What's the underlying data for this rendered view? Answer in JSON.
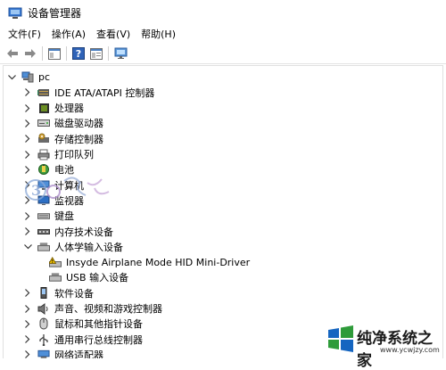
{
  "window": {
    "title": "设备管理器"
  },
  "menu": [
    "文件(F)",
    "操作(A)",
    "查看(V)",
    "帮助(H)"
  ],
  "tree": {
    "root": "pc",
    "items": [
      {
        "label": "IDE ATA/ATAPI 控制器",
        "icon": "ide-controller-icon",
        "expanded": false
      },
      {
        "label": "处理器",
        "icon": "processor-icon",
        "expanded": false
      },
      {
        "label": "磁盘驱动器",
        "icon": "disk-drive-icon",
        "expanded": false
      },
      {
        "label": "存储控制器",
        "icon": "storage-controller-icon",
        "expanded": false
      },
      {
        "label": "打印队列",
        "icon": "printer-icon",
        "expanded": false
      },
      {
        "label": "电池",
        "icon": "battery-icon",
        "expanded": false
      },
      {
        "label": "计算机",
        "icon": "computer-icon",
        "expanded": false
      },
      {
        "label": "监视器",
        "icon": "monitor-icon",
        "expanded": false
      },
      {
        "label": "键盘",
        "icon": "keyboard-icon",
        "expanded": false
      },
      {
        "label": "内存技术设备",
        "icon": "memory-device-icon",
        "expanded": false
      },
      {
        "label": "人体学输入设备",
        "icon": "hid-icon",
        "expanded": true,
        "children": [
          {
            "label": "Insyde Airplane Mode HID Mini-Driver",
            "icon": "hid-warning-icon"
          },
          {
            "label": "USB 输入设备",
            "icon": "hid-device-icon"
          }
        ]
      },
      {
        "label": "软件设备",
        "icon": "software-device-icon",
        "expanded": false
      },
      {
        "label": "声音、视频和游戏控制器",
        "icon": "sound-icon",
        "expanded": false
      },
      {
        "label": "鼠标和其他指针设备",
        "icon": "mouse-icon",
        "expanded": false
      },
      {
        "label": "通用串行总线控制器",
        "icon": "usb-icon",
        "expanded": false
      },
      {
        "label": "网络适配器",
        "icon": "network-adapter-icon",
        "expanded": false
      }
    ]
  },
  "watermark": {
    "text": "纯净系统之家",
    "url": "www.ycwjzy.com"
  },
  "colors": {
    "accent": "#1b6fd6",
    "brand_green": "#2e9b3a",
    "brand_blue": "#1565c0",
    "text": "#000000"
  }
}
